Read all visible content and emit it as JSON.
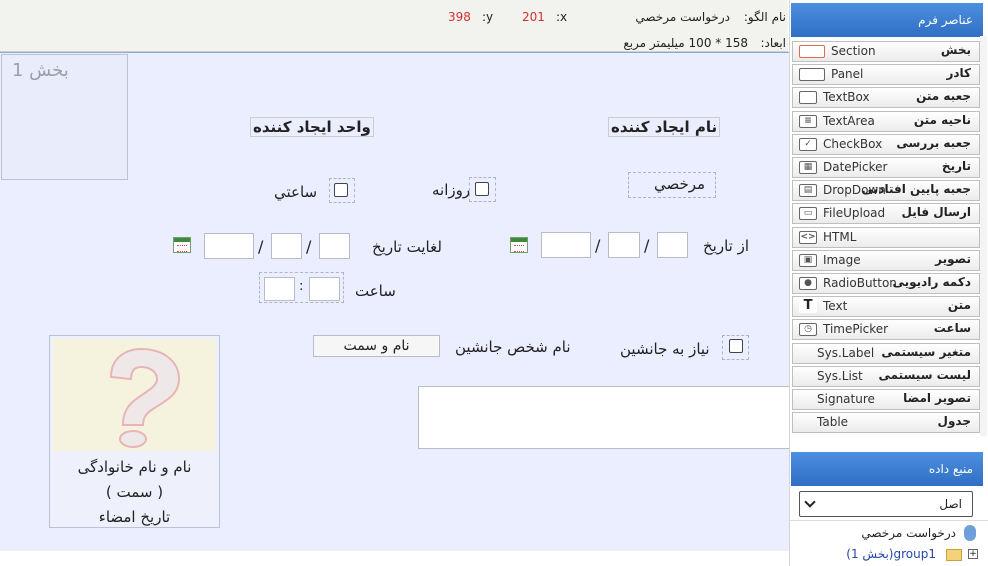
{
  "topbar": {
    "pattern_label": "نام الگو:",
    "pattern_value": "درخواست مرخصي",
    "x_label": "x:",
    "x_value": "201",
    "y_label": "y:",
    "y_value": "398",
    "dims_label": "ابعاد:",
    "dims_value": "158 * 100 میلیمتر مربع"
  },
  "canvas": {
    "section_label": "بخش 1",
    "creator_name": "نام ايجاد کننده",
    "creator_unit": "واحد ايجاد کننده",
    "leave_type_value": "مرخصي",
    "daily_label": "روزانه",
    "hourly_label": "ساعتي",
    "from_date_label": "از تاريخ",
    "to_date_label": "لغايت تاريخ",
    "date_sep": "/",
    "hour_label": "ساعت",
    "time_sep": ":",
    "needs_substitute_label": "نیاز به جانشین",
    "substitute_name_label": "نام شخص جانشين",
    "name_title_box": "نام و سمت",
    "signature_lines": [
      "نام و نام خانوادگی",
      "( سمت )",
      "تاریخ امضاء"
    ]
  },
  "sidebar": {
    "form_elements_title": "عناصر فرم",
    "tools": [
      {
        "fa": "بخش",
        "en": "Section",
        "icon": "section-icon"
      },
      {
        "fa": "کادر",
        "en": "Panel",
        "icon": "panel-icon"
      },
      {
        "fa": "جعبه متن",
        "en": "TextBox",
        "icon": "textbox-icon"
      },
      {
        "fa": "ناحیه متن",
        "en": "TextArea",
        "icon": "textarea-icon"
      },
      {
        "fa": "جعبه بررسی",
        "en": "CheckBox",
        "icon": "checkbox-icon"
      },
      {
        "fa": "تاریخ",
        "en": "DatePicker",
        "icon": "calendar-icon"
      },
      {
        "fa": "جعبه پایین افتادنی",
        "en": "DropDown",
        "icon": "dropdown-icon"
      },
      {
        "fa": "ارسال فایل",
        "en": "FileUpload",
        "icon": "upload-icon"
      },
      {
        "fa": "",
        "en": "HTML",
        "icon": "html-icon"
      },
      {
        "fa": "تصویر",
        "en": "Image",
        "icon": "image-icon"
      },
      {
        "fa": "دکمه رادیویی",
        "en": "RadioButton",
        "icon": "radio-icon"
      },
      {
        "fa": "متن",
        "en": "Text",
        "icon": "text-icon"
      },
      {
        "fa": "ساعت",
        "en": "TimePicker",
        "icon": "clock-icon"
      },
      {
        "fa": "متغیر سیستمی",
        "en": "Sys.Label",
        "icon": ""
      },
      {
        "fa": "لیست سیستمی",
        "en": "Sys.List",
        "icon": ""
      },
      {
        "fa": "تصویر امضا",
        "en": "Signature",
        "icon": ""
      },
      {
        "fa": "جدول",
        "en": "Table",
        "icon": ""
      }
    ],
    "data_source_title": "منبع داده",
    "data_source_selected": "اصل",
    "tree_root": "درخواست مرخصي",
    "tree_child": "group1(بخش 1)"
  },
  "colors": {
    "header_blue": "#3a7fd5",
    "canvas_bg": "#eaeefe",
    "coord_red": "#d0312d"
  }
}
